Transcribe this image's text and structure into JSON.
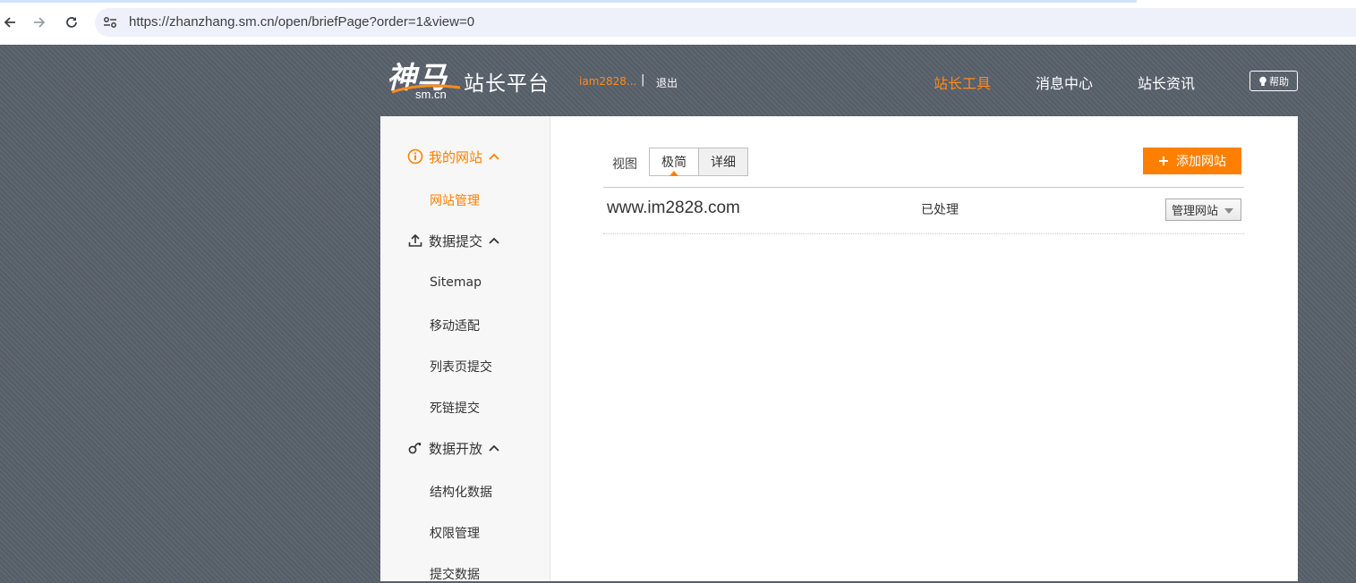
{
  "browser": {
    "url": "https://zhanzhang.sm.cn/open/briefPage?order=1&view=0"
  },
  "header": {
    "logo_cn": "神马",
    "logo_domain": "sm.cn",
    "logo_title": "站长平台",
    "user_name": "iam2828...",
    "separator": "|",
    "logout": "退出",
    "nav": [
      "站长工具",
      "消息中心",
      "站长资讯"
    ],
    "help": "帮助",
    "accent_color": "#ff8a1d"
  },
  "sidebar": {
    "groups": [
      {
        "icon": "info-circle-icon",
        "label": "我的网站",
        "items": [
          "网站管理"
        ]
      },
      {
        "icon": "upload-icon",
        "label": "数据提交",
        "items": [
          "Sitemap",
          "移动适配",
          "列表页提交",
          "死链提交"
        ]
      },
      {
        "icon": "link-icon",
        "label": "数据开放",
        "items": [
          "结构化数据",
          "权限管理",
          "提交数据"
        ]
      }
    ]
  },
  "main": {
    "view_label": "视图",
    "view_options": [
      "极简",
      "详细"
    ],
    "view_selected": "极简",
    "add_site_button": "添加网站",
    "sites": [
      {
        "domain": "www.im2828.com",
        "status": "已处理",
        "action": "管理网站"
      }
    ]
  }
}
